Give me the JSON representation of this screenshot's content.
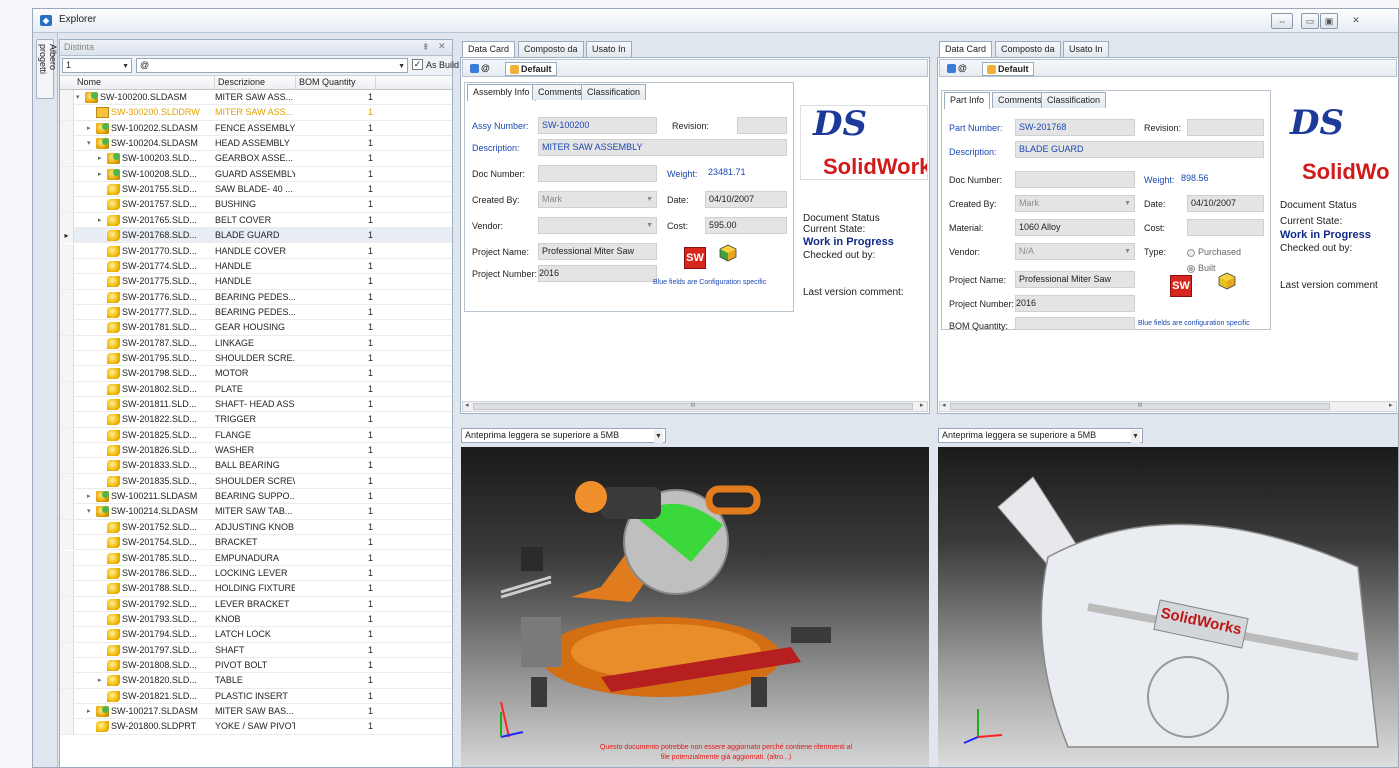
{
  "window": {
    "title": "Explorer",
    "btn_restore": "⇔",
    "btn_min": "▭",
    "btn_max": "▣",
    "btn_close": "✕"
  },
  "sidebar_tab": "Albero progetti",
  "left_panel": {
    "title": "Distinta",
    "pin": "⇞",
    "close": "✕",
    "level_value": "1",
    "config_value": "@",
    "as_build_label": "As Build",
    "columns": [
      "Nome",
      "Descrizione",
      "BOM Quantity"
    ],
    "rows": [
      {
        "name": "SW-100200.SLDASM",
        "desc": "MITER SAW ASS...",
        "qty": "1",
        "type": "asm",
        "indent": 0,
        "exp": "▾"
      },
      {
        "name": "SW-300200.SLDDRW",
        "desc": "MITER SAW ASS...",
        "qty": "1",
        "type": "drw",
        "indent": 1,
        "exp": "",
        "highlight": true
      },
      {
        "name": "SW-100202.SLDASM",
        "desc": "FENCE ASSEMBLY",
        "qty": "1",
        "type": "asm",
        "indent": 1,
        "exp": "▸"
      },
      {
        "name": "SW-100204.SLDASM",
        "desc": "HEAD ASSEMBLY",
        "qty": "1",
        "type": "asm",
        "indent": 1,
        "exp": "▾"
      },
      {
        "name": "SW-100203.SLD...",
        "desc": "GEARBOX ASSE...",
        "qty": "1",
        "type": "asm",
        "indent": 2,
        "exp": "▸"
      },
      {
        "name": "SW-100208.SLD...",
        "desc": "GUARD ASSEMBLY",
        "qty": "1",
        "type": "asm",
        "indent": 2,
        "exp": "▸"
      },
      {
        "name": "SW-201755.SLD...",
        "desc": "SAW BLADE- 40 ...",
        "qty": "1",
        "type": "prt",
        "indent": 2,
        "exp": ""
      },
      {
        "name": "SW-201757.SLD...",
        "desc": "BUSHING",
        "qty": "1",
        "type": "prt",
        "indent": 2,
        "exp": ""
      },
      {
        "name": "SW-201765.SLD...",
        "desc": "BELT COVER",
        "qty": "1",
        "type": "prt",
        "indent": 2,
        "exp": "▸"
      },
      {
        "name": "SW-201768.SLD...",
        "desc": "BLADE GUARD",
        "qty": "1",
        "type": "prt",
        "indent": 2,
        "exp": "",
        "selected": true
      },
      {
        "name": "SW-201770.SLD...",
        "desc": "HANDLE COVER",
        "qty": "1",
        "type": "prt",
        "indent": 2,
        "exp": ""
      },
      {
        "name": "SW-201774.SLD...",
        "desc": "HANDLE",
        "qty": "1",
        "type": "prt",
        "indent": 2,
        "exp": ""
      },
      {
        "name": "SW-201775.SLD...",
        "desc": "HANDLE",
        "qty": "1",
        "type": "prt",
        "indent": 2,
        "exp": ""
      },
      {
        "name": "SW-201776.SLD...",
        "desc": "BEARING PEDES...",
        "qty": "1",
        "type": "prt",
        "indent": 2,
        "exp": ""
      },
      {
        "name": "SW-201777.SLD...",
        "desc": "BEARING PEDES...",
        "qty": "1",
        "type": "prt",
        "indent": 2,
        "exp": ""
      },
      {
        "name": "SW-201781.SLD...",
        "desc": "GEAR HOUSING",
        "qty": "1",
        "type": "prt",
        "indent": 2,
        "exp": ""
      },
      {
        "name": "SW-201787.SLD...",
        "desc": "LINKAGE",
        "qty": "1",
        "type": "prt",
        "indent": 2,
        "exp": ""
      },
      {
        "name": "SW-201795.SLD...",
        "desc": "SHOULDER SCRE...",
        "qty": "1",
        "type": "prt",
        "indent": 2,
        "exp": ""
      },
      {
        "name": "SW-201798.SLD...",
        "desc": "MOTOR",
        "qty": "1",
        "type": "prt",
        "indent": 2,
        "exp": ""
      },
      {
        "name": "SW-201802.SLD...",
        "desc": "PLATE",
        "qty": "1",
        "type": "prt",
        "indent": 2,
        "exp": ""
      },
      {
        "name": "SW-201811.SLD...",
        "desc": "SHAFT- HEAD ASSY",
        "qty": "1",
        "type": "prt",
        "indent": 2,
        "exp": ""
      },
      {
        "name": "SW-201822.SLD...",
        "desc": "TRIGGER",
        "qty": "1",
        "type": "prt",
        "indent": 2,
        "exp": ""
      },
      {
        "name": "SW-201825.SLD...",
        "desc": "FLANGE",
        "qty": "1",
        "type": "prt",
        "indent": 2,
        "exp": ""
      },
      {
        "name": "SW-201826.SLD...",
        "desc": "WASHER",
        "qty": "1",
        "type": "prt",
        "indent": 2,
        "exp": ""
      },
      {
        "name": "SW-201833.SLD...",
        "desc": "BALL BEARING",
        "qty": "1",
        "type": "prt",
        "indent": 2,
        "exp": ""
      },
      {
        "name": "SW-201835.SLD...",
        "desc": "SHOULDER SCREW",
        "qty": "1",
        "type": "prt",
        "indent": 2,
        "exp": ""
      },
      {
        "name": "SW-100211.SLDASM",
        "desc": "BEARING SUPPO...",
        "qty": "1",
        "type": "asm",
        "indent": 1,
        "exp": "▸"
      },
      {
        "name": "SW-100214.SLDASM",
        "desc": "MITER SAW TAB...",
        "qty": "1",
        "type": "asm",
        "indent": 1,
        "exp": "▾"
      },
      {
        "name": "SW-201752.SLD...",
        "desc": "ADJUSTING KNOB",
        "qty": "1",
        "type": "prt",
        "indent": 2,
        "exp": ""
      },
      {
        "name": "SW-201754.SLD...",
        "desc": "BRACKET",
        "qty": "1",
        "type": "prt",
        "indent": 2,
        "exp": ""
      },
      {
        "name": "SW-201785.SLD...",
        "desc": "EMPUNADURA",
        "qty": "1",
        "type": "prt",
        "indent": 2,
        "exp": ""
      },
      {
        "name": "SW-201786.SLD...",
        "desc": "LOCKING LEVER",
        "qty": "1",
        "type": "prt",
        "indent": 2,
        "exp": ""
      },
      {
        "name": "SW-201788.SLD...",
        "desc": "HOLDING FIXTURE",
        "qty": "1",
        "type": "prt",
        "indent": 2,
        "exp": ""
      },
      {
        "name": "SW-201792.SLD...",
        "desc": "LEVER BRACKET",
        "qty": "1",
        "type": "prt",
        "indent": 2,
        "exp": ""
      },
      {
        "name": "SW-201793.SLD...",
        "desc": "KNOB",
        "qty": "1",
        "type": "prt",
        "indent": 2,
        "exp": ""
      },
      {
        "name": "SW-201794.SLD...",
        "desc": "LATCH LOCK",
        "qty": "1",
        "type": "prt",
        "indent": 2,
        "exp": ""
      },
      {
        "name": "SW-201797.SLD...",
        "desc": "SHAFT",
        "qty": "1",
        "type": "prt",
        "indent": 2,
        "exp": ""
      },
      {
        "name": "SW-201808.SLD...",
        "desc": "PIVOT BOLT",
        "qty": "1",
        "type": "prt",
        "indent": 2,
        "exp": ""
      },
      {
        "name": "SW-201820.SLD...",
        "desc": "TABLE",
        "qty": "1",
        "type": "prt",
        "indent": 2,
        "exp": "▸"
      },
      {
        "name": "SW-201821.SLD...",
        "desc": "PLASTIC INSERT",
        "qty": "1",
        "type": "prt",
        "indent": 2,
        "exp": ""
      },
      {
        "name": "SW-100217.SLDASM",
        "desc": "MITER SAW BAS...",
        "qty": "1",
        "type": "asm",
        "indent": 1,
        "exp": "▸"
      },
      {
        "name": "SW-201800.SLDPRT",
        "desc": "YOKE / SAW PIVOT",
        "qty": "1",
        "type": "prt",
        "indent": 1,
        "exp": ""
      }
    ]
  },
  "mid_panel": {
    "tabs": [
      "Data Card",
      "Composto da",
      "Usato In"
    ],
    "cfg_btn": "@",
    "default_btn": "Default",
    "inner_tabs": [
      "Assembly Info",
      "Comments",
      "Classification"
    ],
    "assy_number_label": "Assy Number:",
    "assy_number": "SW-100200",
    "revision_label": "Revision:",
    "description_label": "Description:",
    "description": "MITER SAW ASSEMBLY",
    "doc_number_label": "Doc Number:",
    "weight_label": "Weight:",
    "weight": "23481.71",
    "created_by_label": "Created By:",
    "created_by": "Mark",
    "date_label": "Date:",
    "date": "04/10/2007",
    "vendor_label": "Vendor:",
    "cost_label": "Cost:",
    "cost": "595.00",
    "project_name_label": "Project Name:",
    "project_name": "Professional Miter Saw",
    "project_number_label": "Project Number:",
    "project_number": "2016",
    "blue_note": "Blue fields are Configuration specific",
    "status_title": "Document Status",
    "current_state_label": "Current State:",
    "current_state": "Work in Progress",
    "checked_out_label": "Checked out by:",
    "last_version_label": "Last version comment:",
    "logo_text": "SolidWork",
    "sw_icon": "SW",
    "scroll_mid": "III",
    "preview_option": "Anteprima leggera se superiore a 5MB",
    "warning": "Questo documento potrebbe non essere aggiornato perché contiene riferimenti al file potenzialmente già aggiornati. (altro...)"
  },
  "right_panel": {
    "tabs": [
      "Data Card",
      "Composto da",
      "Usato In"
    ],
    "cfg_btn": "@",
    "default_btn": "Default",
    "inner_tabs": [
      "Part Info",
      "Comments",
      "Classification"
    ],
    "part_number_label": "Part Number:",
    "part_number": "SW-201768",
    "revision_label": "Revision:",
    "description_label": "Description:",
    "description": "BLADE GUARD",
    "doc_number_label": "Doc Number:",
    "weight_label": "Weight:",
    "weight": "898.56",
    "created_by_label": "Created By:",
    "created_by": "Mark",
    "date_label": "Date:",
    "date": "04/10/2007",
    "material_label": "Material:",
    "material": "1060 Alloy",
    "cost_label": "Cost:",
    "vendor_label": "Vendor:",
    "vendor": "N/A",
    "type_label": "Type:",
    "type_purchased": "Purchased",
    "type_built": "Built",
    "project_name_label": "Project Name:",
    "project_name": "Professional Miter Saw",
    "project_number_label": "Project Number:",
    "project_number": "2016",
    "bom_quantity_label": "BOM Quantity:",
    "blue_note": "Blue fields are configuration specific",
    "status_title": "Document Status",
    "current_state_label": "Current State:",
    "current_state": "Work in Progress",
    "checked_out_label": "Checked out by:",
    "last_version_label": "Last version comment",
    "logo_text": "SolidWo",
    "sw_icon": "SW",
    "scroll_mid": "III",
    "preview_option": "Anteprima leggera se superiore a 5MB",
    "part_brand": "SolidWorks"
  },
  "colors": {
    "accent_blue": "#1b48b4",
    "brand_red": "#d11a1a",
    "warning_red": "#e51616"
  }
}
